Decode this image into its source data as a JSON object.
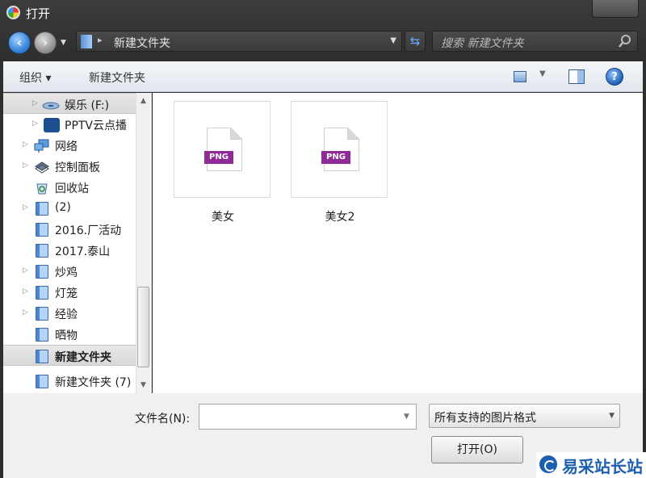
{
  "window": {
    "title": "打开"
  },
  "nav": {
    "address_path": "新建文件夹",
    "search_placeholder": "搜索 新建文件夹"
  },
  "toolbar": {
    "organize_label": "组织 ▾",
    "new_folder_label": "新建文件夹"
  },
  "sidebar": {
    "items": [
      {
        "label": "娱乐 (F:)",
        "icon": "drive-icon"
      },
      {
        "label": "PPTV云点播",
        "icon": "pptv-icon"
      },
      {
        "label": "网络",
        "icon": "network-icon"
      },
      {
        "label": "控制面板",
        "icon": "control-panel-icon"
      },
      {
        "label": "回收站",
        "icon": "recycle-bin-icon"
      },
      {
        "label": "(2)",
        "icon": "folder-icon"
      },
      {
        "label": "2016.厂活动",
        "icon": "folder-icon"
      },
      {
        "label": "2017.泰山",
        "icon": "folder-icon"
      },
      {
        "label": "炒鸡",
        "icon": "folder-icon"
      },
      {
        "label": "灯笼",
        "icon": "folder-icon"
      },
      {
        "label": "经验",
        "icon": "folder-icon"
      },
      {
        "label": "晒物",
        "icon": "folder-icon"
      },
      {
        "label": "新建文件夹",
        "icon": "folder-icon"
      },
      {
        "label": "新建文件夹 (7)",
        "icon": "folder-icon"
      }
    ]
  },
  "files": [
    {
      "name": "美女",
      "badge": "PNG"
    },
    {
      "name": "美女2",
      "badge": "PNG"
    }
  ],
  "bottom": {
    "filename_label": "文件名(N):",
    "filename_value": "",
    "filter_value": "所有支持的图片格式",
    "open_label": "打开(O)"
  },
  "watermark": {
    "text": "易采站长站"
  },
  "colors": {
    "accent": "#2a79d2",
    "png_badge": "#8e2b96"
  }
}
